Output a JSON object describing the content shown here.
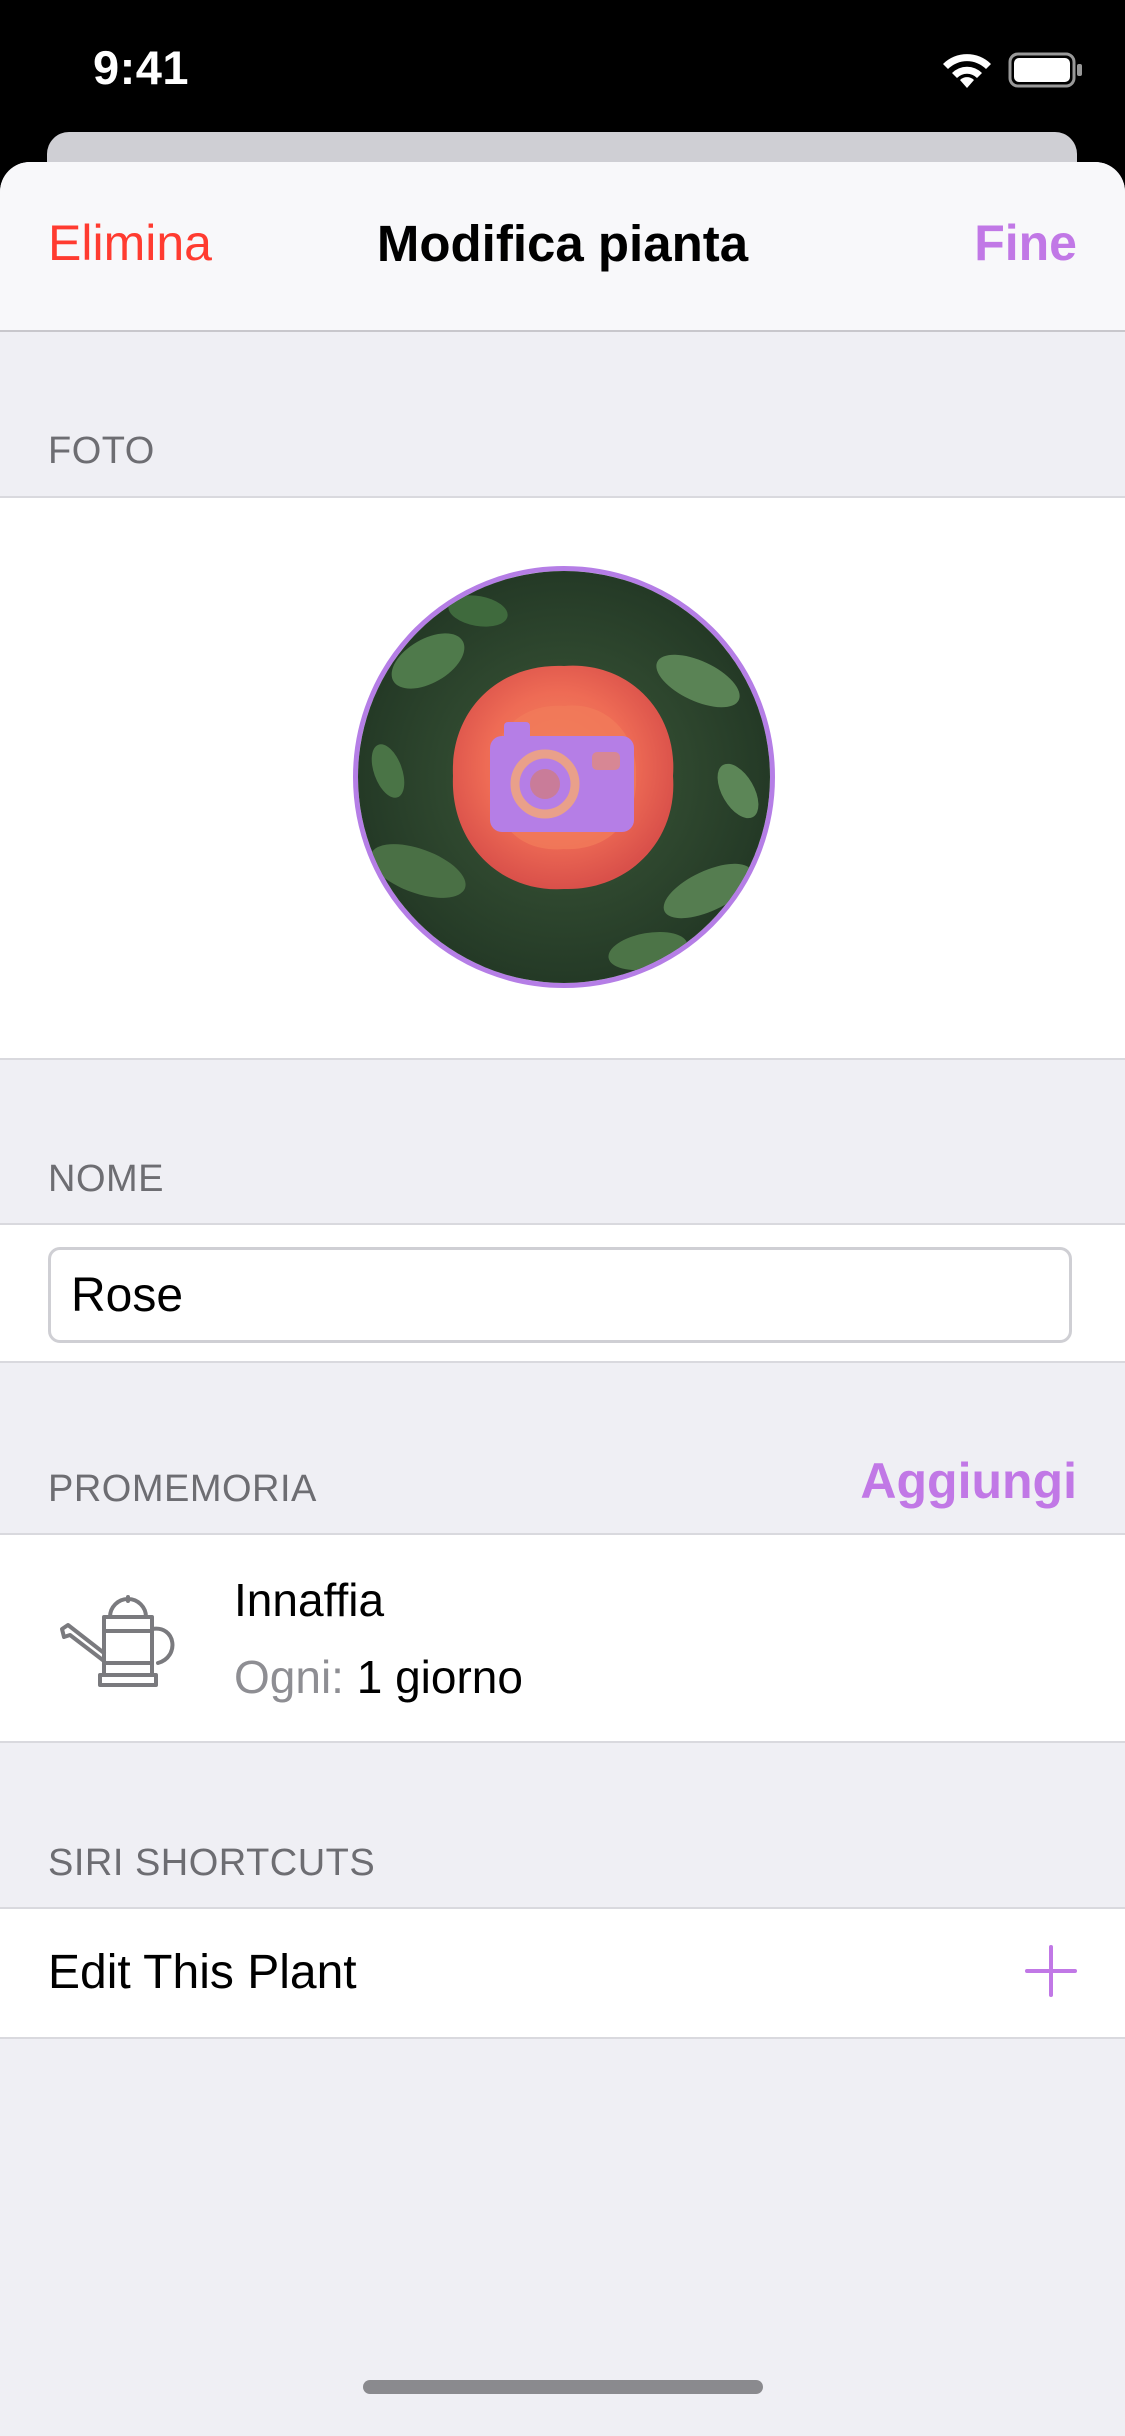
{
  "status_bar": {
    "time": "9:41"
  },
  "nav": {
    "delete_label": "Elimina",
    "title": "Modifica pianta",
    "done_label": "Fine"
  },
  "sections": {
    "photo_header": "FOTO",
    "name_header": "NOME",
    "reminders_header": "PROMEMORIA",
    "reminders_add_label": "Aggiungi",
    "siri_header": "SIRI SHORTCUTS"
  },
  "name_field": {
    "value": "Rose"
  },
  "reminder": {
    "title": "Innaffia",
    "frequency_prefix": "Ogni:",
    "frequency_value": "1 giorno",
    "icon": "watering-can-icon"
  },
  "siri_shortcut": {
    "label": "Edit This Plant",
    "icon": "plus-icon"
  },
  "photo": {
    "subject": "rose",
    "overlay_icon": "camera-icon"
  },
  "colors": {
    "accent": "#c178e6",
    "destructive": "#ff3b30",
    "background": "#efeff4",
    "section_text": "#6d6d72"
  }
}
